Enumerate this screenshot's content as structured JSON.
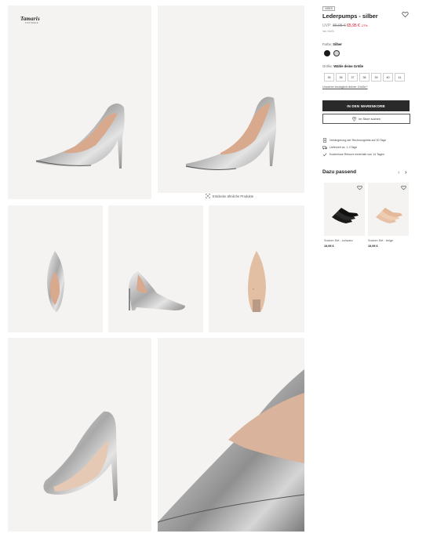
{
  "brand": {
    "name": "Tamaris",
    "sub": "FOOTWEAR"
  },
  "gallery": {
    "similar_label": "Entdecke ähnliche Produkte",
    "images": [
      "shoe-side-left",
      "shoe-side-right",
      "shoe-top",
      "shoe-front",
      "shoe-sole",
      "shoe-back",
      "shoe-toe-closeup"
    ]
  },
  "product": {
    "badge": "VIBES",
    "title": "Lederpumps - silber",
    "uvp_label": "UVP:",
    "old_price": "89,95 €",
    "new_price": "65,95 €",
    "discount": "-27%",
    "vat_note": "inkl. MwSt.",
    "color_label": "Farbe:",
    "color_value": "Silber",
    "colors": [
      "#1a1a1a",
      "#d4d4d4"
    ],
    "size_label": "Größe:",
    "size_value": "Wähle deine Größe",
    "sizes": [
      "35",
      "36",
      "37",
      "38",
      "39",
      "40",
      "41"
    ],
    "size_link": "Unsicher bezüglich deiner Größe?",
    "cart_button": "IN DEN WARENKORB",
    "store_button": "Im Store suchen",
    "info": [
      "Verlängerung der Rechnungsfrist auf 30 Tage",
      "Lieferzeit ca. 1-3 Tage",
      "Kostenlose Retoure innerhalb von 14 Tagen"
    ]
  },
  "recommendations": {
    "title": "Dazu passend",
    "items": [
      {
        "name": "Socken Set - schwarz",
        "price": "19,95 €"
      },
      {
        "name": "Socken Set - beige",
        "price": "19,95 €"
      }
    ]
  }
}
